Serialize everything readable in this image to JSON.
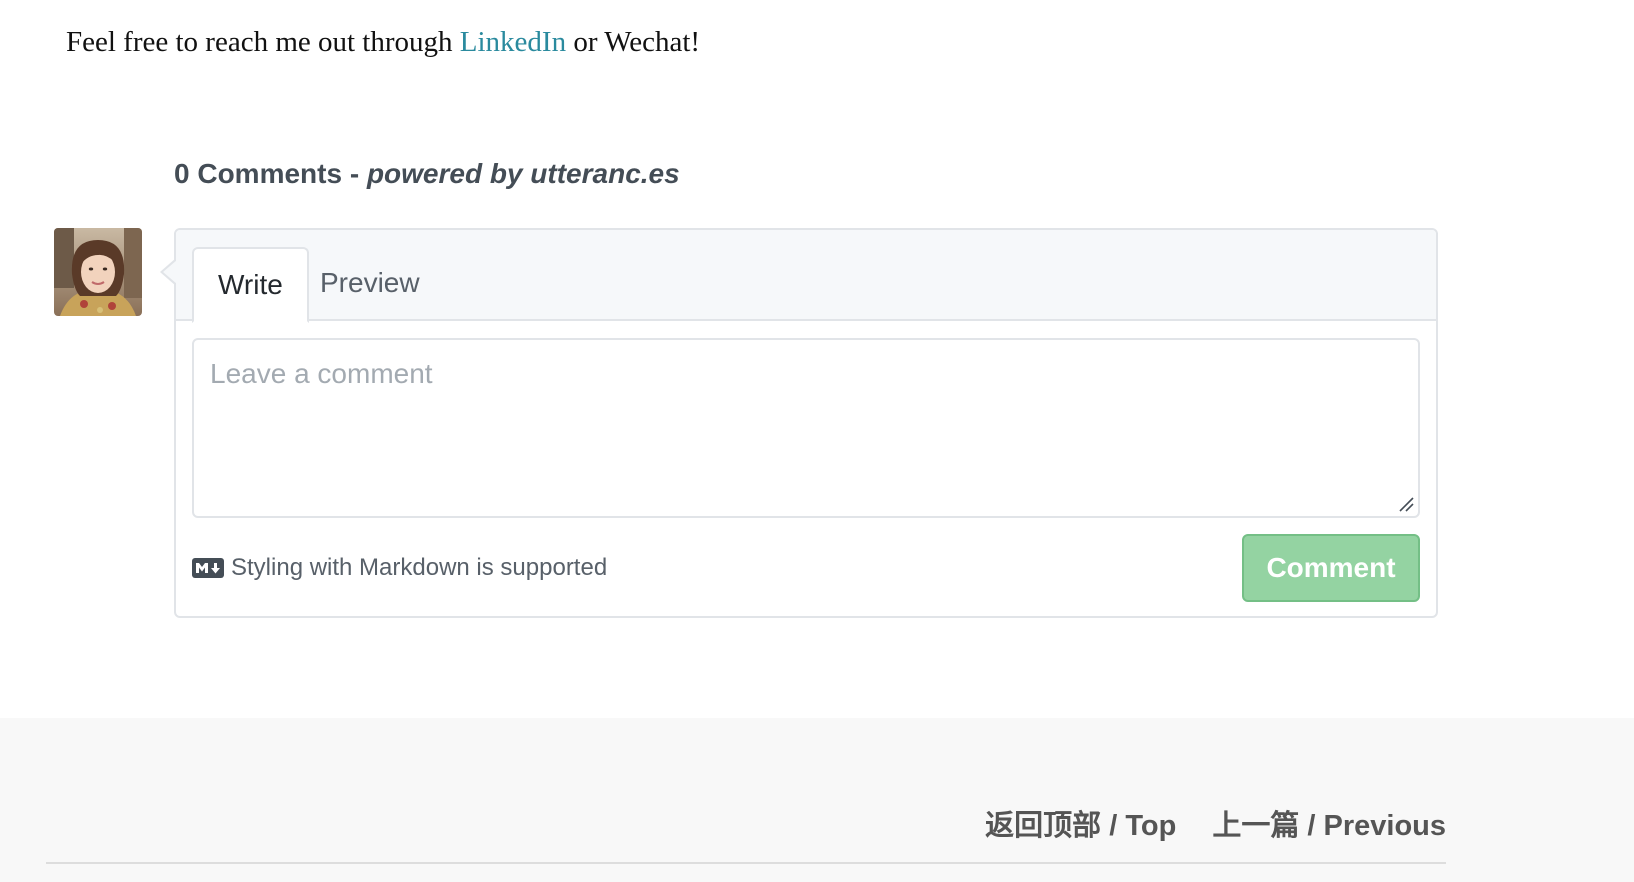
{
  "intro": {
    "text_before": "Feel free to reach me out through ",
    "link_label": "LinkedIn",
    "text_after": " or Wechat!"
  },
  "comments": {
    "count_label": "0 Comments",
    "separator": " - ",
    "powered_by": "powered by utteranc.es",
    "tabs": [
      {
        "label": "Write",
        "active": true
      },
      {
        "label": "Preview",
        "active": false
      }
    ],
    "textarea": {
      "placeholder": "Leave a comment",
      "value": ""
    },
    "markdown_note": "Styling with Markdown is supported",
    "markdown_icon": "markdown-icon",
    "submit_label": "Comment",
    "submit_color": "#94d3a2"
  },
  "footer": {
    "top_link": "返回顶部 / Top",
    "previous_link": "上一篇 / Previous"
  },
  "colors": {
    "link": "#2a8a9e",
    "tab_bar_bg": "#f6f8fa",
    "border": "#e1e4e8",
    "footer_bg": "#f8f8f8"
  }
}
